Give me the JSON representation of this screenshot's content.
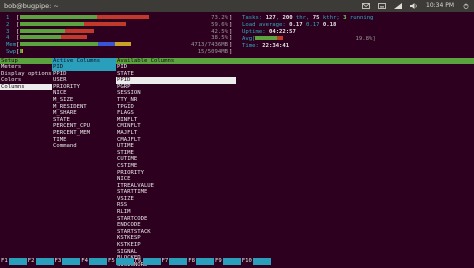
{
  "window": {
    "title": "bob@bugpipe: ~",
    "time": "10:34 PM"
  },
  "tray_icons": [
    "envelope-icon",
    "keyboard-icon",
    "network-icon",
    "volume-icon",
    "power-icon"
  ],
  "colors": {
    "bg": "#2c001e",
    "cyan": "#31a9c1",
    "green": "#5ba33f",
    "red": "#c0392b",
    "blue": "#3a54d4"
  },
  "meters": [
    {
      "label": "1",
      "value": "73.2%",
      "fraction": 0.73
    },
    {
      "label": "2",
      "value": "59.6%",
      "fraction": 0.6
    },
    {
      "label": "3",
      "value": "42.5%",
      "fraction": 0.42
    },
    {
      "label": "4",
      "value": "38.5%",
      "fraction": 0.38
    },
    {
      "label": "Mem",
      "value": "4713/7436MB",
      "fraction": 0.63
    },
    {
      "label": "Swp",
      "value": "15/5094MB",
      "fraction": 0.01
    }
  ],
  "info": {
    "tasks_label": "Tasks:",
    "tasks": "127",
    "thr_label": ", ",
    "thr": "200",
    "thr_suffix": " thr, ",
    "kthr": "75",
    "kthr_suffix": " kthr; ",
    "running": "3",
    "running_suffix": " running",
    "load_label": "Load average: ",
    "load1": "0.17",
    "load5": "0.17",
    "load15": "0.18",
    "uptime_label": "Uptime: ",
    "uptime": "04:22:57",
    "avg_label": "Avg[",
    "avg_value": "19.8%]",
    "time_label": "Time: ",
    "time": "22:34:41"
  },
  "setup": {
    "setup_header": "Setup",
    "setup_items": [
      "Meters",
      "Display options",
      "Colors",
      "Columns"
    ],
    "active_header": "Active Columns",
    "active_columns": [
      "PID",
      "PPID",
      "USER",
      "PRIORITY",
      "NICE",
      "M_SIZE",
      "M_RESIDENT",
      "M_SHARE",
      "STATE",
      "PERCENT_CPU",
      "PERCENT_MEM",
      "TIME",
      "Command"
    ],
    "available_header": "Available Columns",
    "available_columns": [
      "PID",
      "STATE",
      "PPID",
      "PGRP",
      "SESSION",
      "TTY_NR",
      "TPGID",
      "FLAGS",
      "MINFLT",
      "CMINFLT",
      "MAJFLT",
      "CMAJFLT",
      "UTIME",
      "STIME",
      "CUTIME",
      "CSTIME",
      "PRIORITY",
      "NICE",
      "ITREALVALUE",
      "STARTTIME",
      "VSIZE",
      "RSS",
      "RLIM",
      "STARTCODE",
      "ENDCODE",
      "STARTSTACK",
      "KSTKESP",
      "KSTKEIP",
      "SIGNAL",
      "BLOCKED",
      "SIGIGNORE"
    ]
  },
  "fkeys": [
    "F1",
    "F2",
    "F3",
    "F4",
    "F5",
    "F6",
    "F7",
    "F8",
    "F9",
    "F10"
  ]
}
